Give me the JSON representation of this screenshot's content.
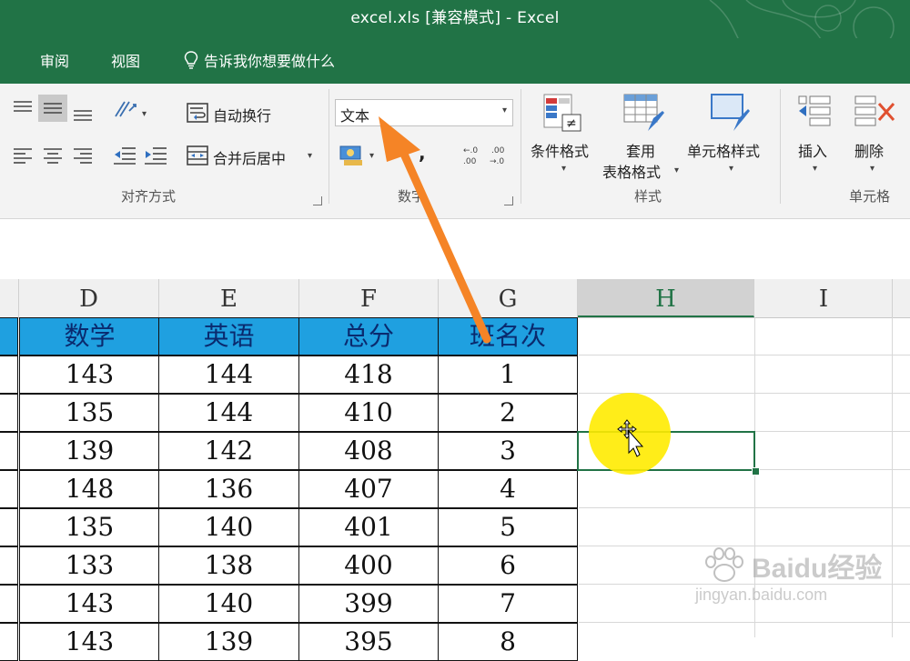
{
  "window": {
    "title": "excel.xls  [兼容模式]  -  Excel"
  },
  "tabs": [
    {
      "label": "审阅"
    },
    {
      "label": "视图"
    }
  ],
  "tell_me": {
    "label": "告诉我你想要做什么"
  },
  "ribbon": {
    "alignment": {
      "wrap_text": "自动换行",
      "merge_center": "合并后居中",
      "group_label": "对齐方式"
    },
    "number": {
      "format_value": "文本",
      "comma": ",",
      "decimal_increase": ".0 .00",
      "decimal_decrease": ".00 .0",
      "group_label": "数字"
    },
    "styles": {
      "conditional_format": "条件格式",
      "table_format_line1": "套用",
      "table_format_line2": "表格格式",
      "cell_styles": "单元格样式",
      "group_label": "样式"
    },
    "cells": {
      "insert": "插入",
      "delete": "删除",
      "group_label": "单元格"
    }
  },
  "columns": [
    "D",
    "E",
    "F",
    "G",
    "H",
    "I"
  ],
  "selected_column": "H",
  "table": {
    "headers": [
      "数学",
      "英语",
      "总分",
      "班名次"
    ],
    "rows": [
      [
        "143",
        "144",
        "418",
        "1"
      ],
      [
        "135",
        "144",
        "410",
        "2"
      ],
      [
        "139",
        "142",
        "408",
        "3"
      ],
      [
        "148",
        "136",
        "407",
        "4"
      ],
      [
        "135",
        "140",
        "401",
        "5"
      ],
      [
        "133",
        "138",
        "400",
        "6"
      ],
      [
        "143",
        "140",
        "399",
        "7"
      ],
      [
        "143",
        "139",
        "395",
        "8"
      ]
    ]
  },
  "watermark": {
    "brand": "Baidu经验",
    "url": "jingyan.baidu.com"
  },
  "colors": {
    "excel_green": "#217346",
    "header_fill": "#1fa0e0",
    "annotation_arrow": "#f58426",
    "cursor_highlight": "#ffeb00"
  }
}
